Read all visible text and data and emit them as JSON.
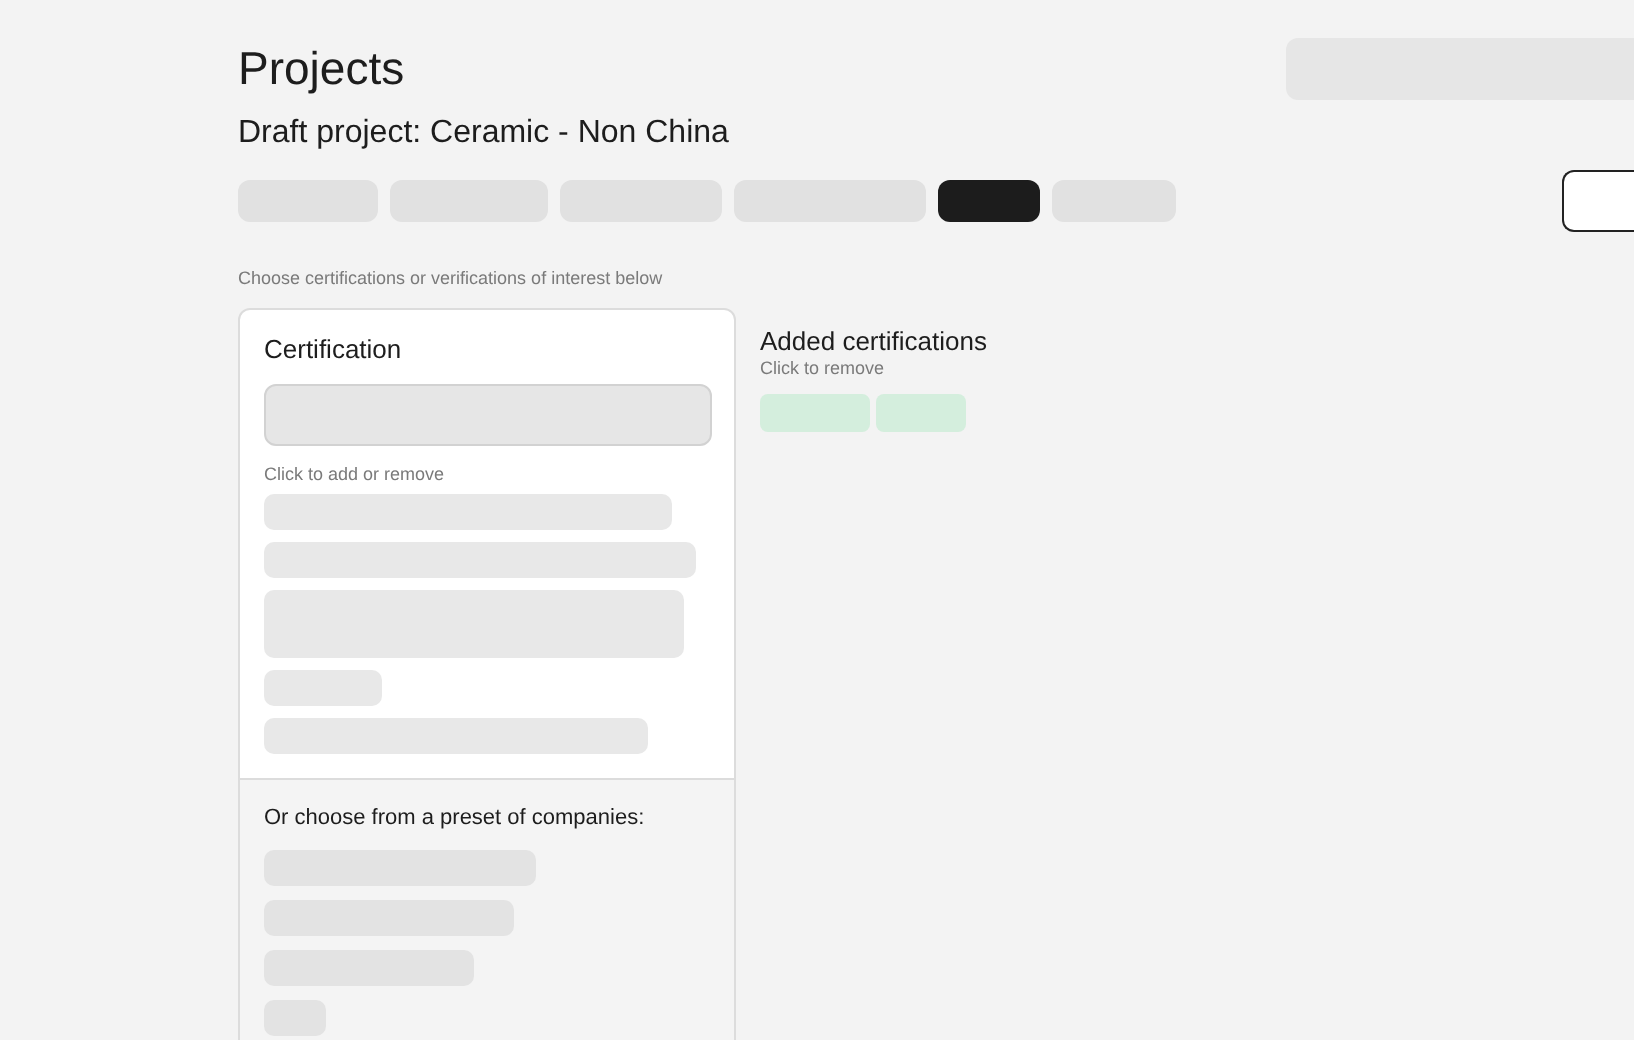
{
  "page_title": "Projects",
  "header_placeholder": {
    "kind": "skeleton"
  },
  "project_title": "Draft project: Ceramic - Non China",
  "tabs": [
    {
      "selected": false
    },
    {
      "selected": false
    },
    {
      "selected": false
    },
    {
      "selected": false
    },
    {
      "selected": true
    },
    {
      "selected": false
    }
  ],
  "side_button": {
    "kind": "outline"
  },
  "instruction": "Choose certifications or verifications of interest below",
  "certification_panel": {
    "heading": "Certification",
    "field": {
      "kind": "skeleton"
    },
    "hint": "Click to add or remove",
    "options": [
      {
        "kind": "skeleton"
      },
      {
        "kind": "skeleton"
      },
      {
        "kind": "skeleton-tall"
      },
      {
        "kind": "skeleton"
      },
      {
        "kind": "skeleton"
      }
    ],
    "preset_heading": "Or choose from a preset of companies:",
    "presets": [
      {
        "kind": "skeleton"
      },
      {
        "kind": "skeleton"
      },
      {
        "kind": "skeleton"
      },
      {
        "kind": "skeleton"
      }
    ]
  },
  "added_certifications": {
    "heading": "Added certifications",
    "hint": "Click to remove",
    "tags": [
      {
        "kind": "skeleton"
      },
      {
        "kind": "skeleton"
      }
    ]
  }
}
